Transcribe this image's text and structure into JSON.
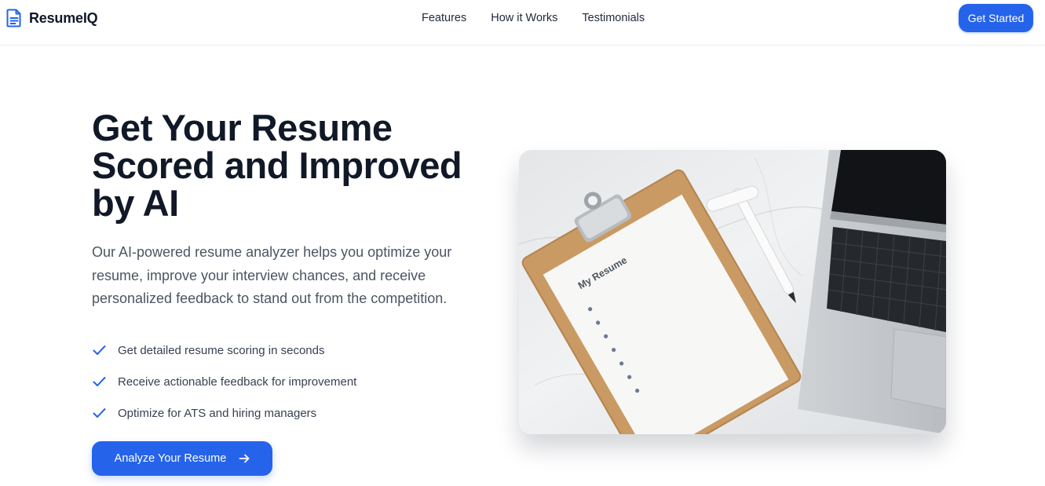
{
  "header": {
    "brand": "ResumeIQ",
    "logo_icon": "document-icon",
    "nav": [
      "Features",
      "How it Works",
      "Testimonials"
    ],
    "cta_label": "Get Started"
  },
  "hero": {
    "headline": "Get Your Resume Scored and Improved by AI",
    "subheading": "Our AI-powered resume analyzer helps you optimize your resume, improve your interview chances, and receive personalized feedback to stand out from the competition.",
    "features": [
      "Get detailed resume scoring in seconds",
      "Receive actionable feedback for improvement",
      "Optimize for ATS and hiring managers"
    ],
    "feature_icon": "check-icon",
    "cta_label": "Analyze Your Resume",
    "cta_icon": "arrow-right-icon",
    "image": {
      "clipboard_text": "My Resume",
      "description_icon": "clipboard-laptop-photo"
    }
  },
  "colors": {
    "accent": "#2563eb",
    "heading": "#111827",
    "body": "#4b5563"
  }
}
